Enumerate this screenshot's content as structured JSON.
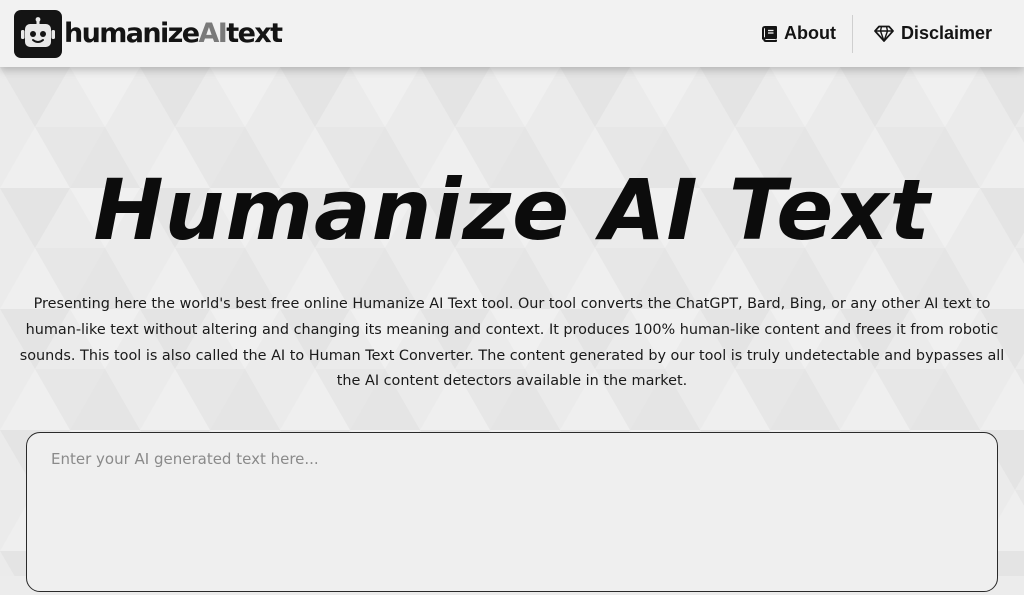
{
  "header": {
    "logo": {
      "text_main": "humanize",
      "text_accent": "AI",
      "text_end": "text",
      "icon": "robot-icon"
    },
    "nav": [
      {
        "label": "About",
        "icon": "book-icon"
      },
      {
        "label": "Disclaimer",
        "icon": "diamond-icon"
      }
    ]
  },
  "main": {
    "title": "Humanize AI Text",
    "intro": "Presenting here the world's best free online Humanize AI Text tool. Our tool converts the ChatGPT, Bard, Bing, or any other AI text to human-like text without altering and changing its meaning and context. It produces 100% human-like content and frees it from robotic sounds. This tool is also called the AI to Human Text Converter. The content generated by our tool is truly undetectable and bypasses all the AI content detectors available in the market.",
    "input": {
      "placeholder": "Enter your AI generated text here...",
      "value": ""
    }
  },
  "colors": {
    "accent": "#141414",
    "logo_ai": "#7a7a7a",
    "background": "#ececec",
    "header_bg": "#f2f2f2"
  }
}
